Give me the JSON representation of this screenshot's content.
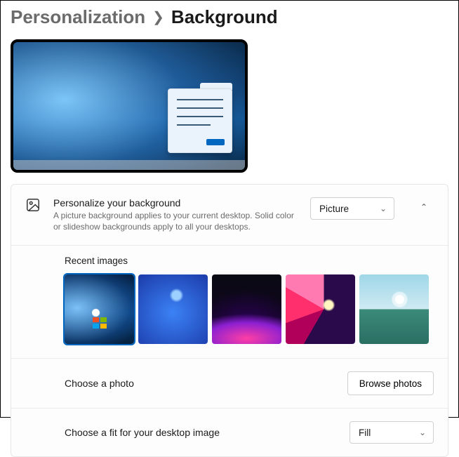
{
  "breadcrumb": {
    "parent": "Personalization",
    "current": "Background"
  },
  "panel": {
    "heading": "Personalize your background",
    "description": "A picture background applies to your current desktop. Solid color or slideshow backgrounds apply to all your desktops.",
    "type_select": {
      "value": "Picture"
    },
    "recent_label": "Recent images",
    "choose_photo_label": "Choose a photo",
    "browse_button": "Browse photos",
    "fit_label": "Choose a fit for your desktop image",
    "fit_select": {
      "value": "Fill"
    }
  }
}
